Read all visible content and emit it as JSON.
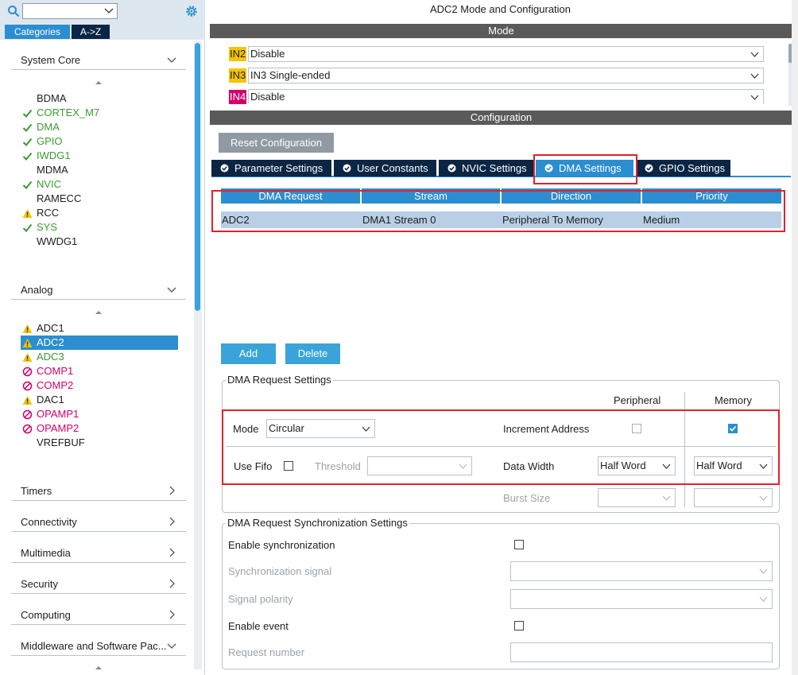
{
  "left": {
    "tabs": [
      "Categories",
      "A->Z"
    ],
    "sections": [
      {
        "title": "System Core",
        "expanded": true
      },
      {
        "title": "Analog",
        "expanded": true
      },
      {
        "title": "Timers",
        "expanded": false
      },
      {
        "title": "Connectivity",
        "expanded": false
      },
      {
        "title": "Multimedia",
        "expanded": false
      },
      {
        "title": "Security",
        "expanded": false
      },
      {
        "title": "Computing",
        "expanded": false
      },
      {
        "title": "Middleware and Software Pac...",
        "expanded": false
      }
    ],
    "system_core_items": [
      {
        "label": "BDMA",
        "status": "none"
      },
      {
        "label": "CORTEX_M7",
        "status": "ok"
      },
      {
        "label": "DMA",
        "status": "ok"
      },
      {
        "label": "GPIO",
        "status": "ok"
      },
      {
        "label": "IWDG1",
        "status": "ok"
      },
      {
        "label": "MDMA",
        "status": "none"
      },
      {
        "label": "NVIC",
        "status": "ok"
      },
      {
        "label": "RAMECC",
        "status": "none"
      },
      {
        "label": "RCC",
        "status": "warn"
      },
      {
        "label": "SYS",
        "status": "ok"
      },
      {
        "label": "WWDG1",
        "status": "none"
      }
    ],
    "analog_items": [
      {
        "label": "ADC1",
        "status": "warn"
      },
      {
        "label": "ADC2",
        "status": "warn",
        "selected": true
      },
      {
        "label": "ADC3",
        "status": "warn"
      },
      {
        "label": "COMP1",
        "status": "blocked"
      },
      {
        "label": "COMP2",
        "status": "blocked"
      },
      {
        "label": "DAC1",
        "status": "warn"
      },
      {
        "label": "OPAMP1",
        "status": "blocked"
      },
      {
        "label": "OPAMP2",
        "status": "blocked"
      },
      {
        "label": "VREFBUF",
        "status": "none"
      }
    ]
  },
  "main": {
    "title": "ADC2 Mode and Configuration",
    "mode_bar": "Mode",
    "mode_rows": [
      {
        "pin": "IN2",
        "value": "Disable"
      },
      {
        "pin": "IN3",
        "value": "IN3 Single-ended"
      },
      {
        "pin": "IN4",
        "value": "Disable"
      }
    ],
    "config_bar": "Configuration",
    "reset_button": "Reset Configuration",
    "tabs": [
      "Parameter Settings",
      "User Constants",
      "NVIC Settings",
      "DMA Settings",
      "GPIO Settings"
    ],
    "active_tab": "DMA Settings",
    "dma_table": {
      "columns": [
        "DMA Request",
        "Stream",
        "Direction",
        "Priority"
      ],
      "rows": [
        [
          "ADC2",
          "DMA1 Stream 0",
          "Peripheral To Memory",
          "Medium"
        ]
      ]
    },
    "add_button": "Add",
    "delete_button": "Delete",
    "request_settings": {
      "title": "DMA Request Settings",
      "col_peripheral": "Peripheral",
      "col_memory": "Memory",
      "mode_label": "Mode",
      "mode_value": "Circular",
      "increment_label": "Increment Address",
      "increment_peripheral": false,
      "increment_memory": true,
      "fifo_label": "Use Fifo",
      "fifo_checked": false,
      "threshold_label": "Threshold",
      "threshold_value": "",
      "data_width_label": "Data Width",
      "data_width_peripheral": "Half Word",
      "data_width_memory": "Half Word",
      "burst_label": "Burst Size"
    },
    "sync_settings": {
      "title": "DMA Request Synchronization Settings",
      "enable_sync_label": "Enable synchronization",
      "sync_signal_label": "Synchronization signal",
      "signal_polarity_label": "Signal polarity",
      "enable_event_label": "Enable event",
      "request_number_label": "Request number"
    }
  },
  "colors": {
    "accent": "#2b8ed0",
    "dark_tab": "#0b2544",
    "ok": "#3c9a34",
    "warn": "#f5c400",
    "blocked": "#d3006b",
    "highlight": "#e0232b"
  }
}
